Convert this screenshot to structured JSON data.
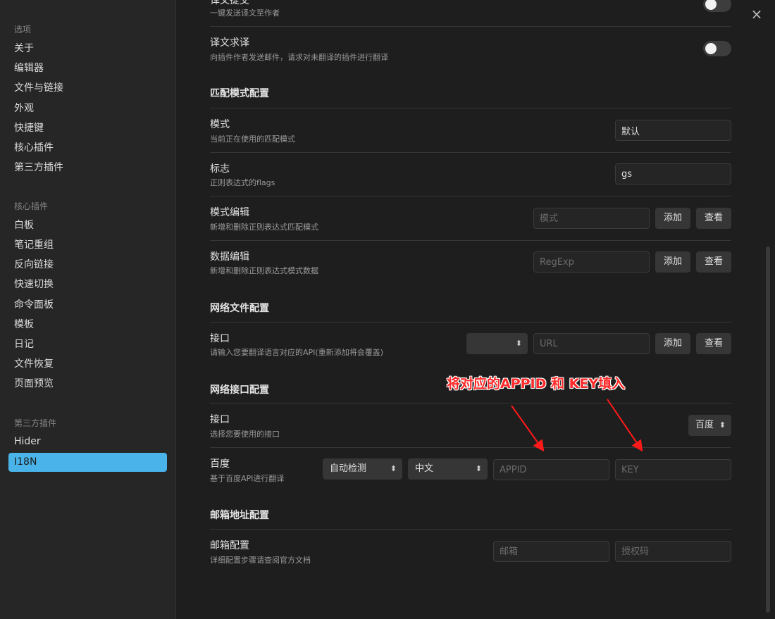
{
  "sidebar": {
    "group_options": "选项",
    "options": [
      "关于",
      "编辑器",
      "文件与链接",
      "外观",
      "快捷键",
      "核心插件",
      "第三方插件"
    ],
    "group_core": "核心插件",
    "core": [
      "白板",
      "笔记重组",
      "反向链接",
      "快速切换",
      "命令面板",
      "模板",
      "日记",
      "文件恢复",
      "页面预览"
    ],
    "group_third": "第三方插件",
    "third": [
      "Hider",
      "I18N"
    ]
  },
  "settings": {
    "top_partial": {
      "title": "译文提交",
      "desc": "一键发送译文至作者",
      "toggle_on": false
    },
    "request": {
      "title": "译文求译",
      "desc": "向插件作者发送邮件，请求对未翻译的插件进行翻译",
      "toggle_on": false
    },
    "match_section": "匹配模式配置",
    "mode": {
      "title": "模式",
      "desc": "当前正在使用的匹配模式",
      "value": "默认"
    },
    "flags": {
      "title": "标志",
      "desc": "正则表达式的flags",
      "value": "gs"
    },
    "mode_edit": {
      "title": "模式编辑",
      "desc": "新增和删除正则表达式匹配模式",
      "placeholder": "模式",
      "add": "添加",
      "view": "查看"
    },
    "data_edit": {
      "title": "数据编辑",
      "desc": "新增和删除正则表达式模式数据",
      "placeholder": "RegExp",
      "add": "添加",
      "view": "查看"
    },
    "net_file_section": "网络文件配置",
    "net_file": {
      "title": "接口",
      "desc": "请输入您要翻译语言对应的API(重新添加将会覆盖)",
      "select_value": "",
      "placeholder": "URL",
      "add": "添加",
      "view": "查看"
    },
    "net_api_section": "网络接口配置",
    "api": {
      "title": "接口",
      "desc": "选择您要使用的接口",
      "value": "百度"
    },
    "baidu": {
      "title": "百度",
      "desc": "基于百度API进行翻译",
      "from": "自动检测",
      "to": "中文",
      "appid_placeholder": "APPID",
      "key_placeholder": "KEY"
    },
    "email_section": "邮箱地址配置",
    "email": {
      "title": "邮箱配置",
      "desc": "详细配置步骤请查阅官方文档",
      "email_placeholder": "邮箱",
      "code_placeholder": "授权码"
    }
  },
  "annotation": "将对应的APPID 和 KEY填入",
  "colors": {
    "accent": "#4ab3ea",
    "annotation": "#ff2a2a"
  },
  "icons": {
    "close": "×",
    "chevron": "⌃⌄"
  }
}
